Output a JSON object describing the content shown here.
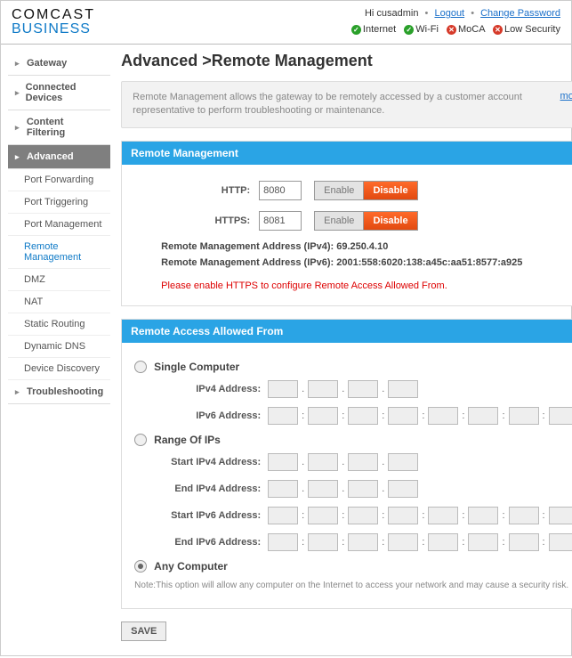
{
  "header": {
    "logo_line1": "COMCAST",
    "logo_line2": "BUSINESS",
    "greeting_prefix": "Hi ",
    "username": "cusadmin",
    "logout": "Logout",
    "change_password": "Change Password",
    "status": {
      "internet": "Internet",
      "wifi": "Wi-Fi",
      "moca": "MoCA",
      "low_security": "Low Security"
    }
  },
  "sidebar": {
    "gateway": "Gateway",
    "connected_devices": "Connected Devices",
    "content_filtering": "Content Filtering",
    "advanced": "Advanced",
    "advanced_sub": {
      "port_forwarding": "Port Forwarding",
      "port_triggering": "Port Triggering",
      "port_management": "Port Management",
      "remote_management": "Remote Management",
      "dmz": "DMZ",
      "nat": "NAT",
      "static_routing": "Static Routing",
      "dynamic_dns": "Dynamic DNS",
      "device_discovery": "Device Discovery"
    },
    "troubleshooting": "Troubleshooting"
  },
  "main": {
    "title": "Advanced >Remote Management",
    "intro": "Remote Management allows the gateway to be remotely accessed by a customer account representative to perform troubleshooting or maintenance.",
    "more": "more",
    "panel1": {
      "heading": "Remote Management",
      "http_label": "HTTP:",
      "http_value": "8080",
      "https_label": "HTTPS:",
      "https_value": "8081",
      "enable": "Enable",
      "disable": "Disable",
      "addr_ipv4_label": "Remote Management Address (IPv4):",
      "addr_ipv4_value": "69.250.4.10",
      "addr_ipv6_label": "Remote Management Address (IPv6):",
      "addr_ipv6_value": "2001:558:6020:138:a45c:aa51:8577:a925",
      "warning": "Please enable HTTPS to configure Remote Access Allowed From."
    },
    "panel2": {
      "heading": "Remote Access Allowed From",
      "single_computer": "Single Computer",
      "ipv4_address": "IPv4 Address:",
      "ipv6_address": "IPv6 Address:",
      "range_of_ips": "Range Of IPs",
      "start_ipv4": "Start IPv4 Address:",
      "end_ipv4": "End IPv4 Address:",
      "start_ipv6": "Start IPv6 Address:",
      "end_ipv6": "End IPv6 Address:",
      "any_computer": "Any Computer",
      "note": "Note:This option will allow any computer on the Internet to access your network and may cause a security risk."
    },
    "save": "SAVE"
  }
}
